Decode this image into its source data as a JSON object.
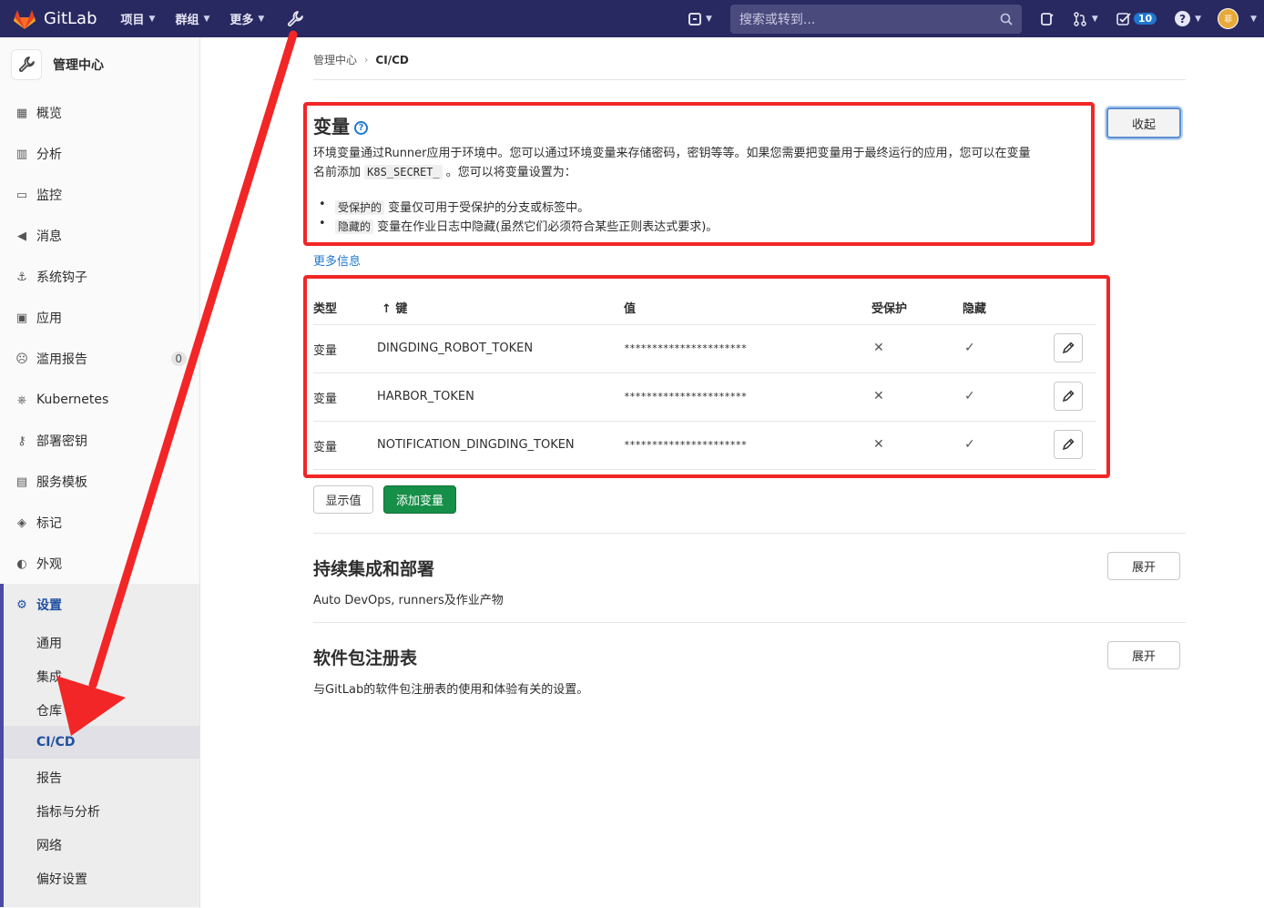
{
  "navbar": {
    "brand": "GitLab",
    "menu": [
      {
        "label": "项目"
      },
      {
        "label": "群组"
      },
      {
        "label": "更多"
      }
    ],
    "search_placeholder": "搜索或转到...",
    "todo_count": "10",
    "avatar_text": "菲"
  },
  "sidebar": {
    "title": "管理中心",
    "items": [
      {
        "label": "概览",
        "icon": "overview-icon"
      },
      {
        "label": "分析",
        "icon": "analytics-icon"
      },
      {
        "label": "监控",
        "icon": "monitor-icon"
      },
      {
        "label": "消息",
        "icon": "messages-icon"
      },
      {
        "label": "系统钩子",
        "icon": "hook-icon"
      },
      {
        "label": "应用",
        "icon": "applications-icon"
      },
      {
        "label": "滥用报告",
        "icon": "abuse-icon",
        "count": "0"
      },
      {
        "label": "Kubernetes",
        "icon": "kubernetes-icon"
      },
      {
        "label": "部署密钥",
        "icon": "key-icon"
      },
      {
        "label": "服务模板",
        "icon": "template-icon"
      },
      {
        "label": "标记",
        "icon": "label-icon"
      },
      {
        "label": "外观",
        "icon": "appearance-icon"
      }
    ],
    "settings": {
      "label": "设置",
      "sub": [
        "通用",
        "集成",
        "仓库",
        "CI/CD",
        "报告",
        "指标与分析",
        "网络",
        "偏好设置"
      ]
    }
  },
  "breadcrumb": {
    "parent": "管理中心",
    "current": "CI/CD"
  },
  "variables": {
    "title": "变量",
    "description_1": "环境变量通过Runner应用于环境中。您可以通过环境变量来存储密码，密钥等等。如果您需要把变量用于最终运行的应用，您可以在变量",
    "description_2_pre": "名前添加",
    "description_2_code": "K8S_SECRET_",
    "description_2_post": "。您可以将变量设置为：",
    "bullet_1_code": "受保护的",
    "bullet_1_text": "变量仅可用于受保护的分支或标签中。",
    "bullet_2_code": "隐藏的",
    "bullet_2_text": "变量在作业日志中隐藏(虽然它们必须符合某些正则表达式要求)。",
    "more_info": "更多信息",
    "collapse_label": "收起",
    "columns": {
      "type": "类型",
      "key": "↑ 键",
      "value": "值",
      "protected": "受保护",
      "masked": "隐藏"
    },
    "rows": [
      {
        "type": "变量",
        "key": "DINGDING_ROBOT_TOKEN",
        "value": "**********************",
        "protected": "✕",
        "masked": "✓"
      },
      {
        "type": "变量",
        "key": "HARBOR_TOKEN",
        "value": "**********************",
        "protected": "✕",
        "masked": "✓"
      },
      {
        "type": "变量",
        "key": "NOTIFICATION_DINGDING_TOKEN",
        "value": "**********************",
        "protected": "✕",
        "masked": "✓"
      }
    ],
    "reveal_label": "显示值",
    "add_label": "添加变量"
  },
  "ci_section": {
    "title": "持续集成和部署",
    "description": "Auto DevOps, runners及作业产物",
    "expand_label": "展开"
  },
  "registry_section": {
    "title": "软件包注册表",
    "description": "与GitLab的软件包注册表的使用和体验有关的设置。",
    "expand_label": "展开"
  },
  "colors": {
    "navbar": "#292961",
    "highlight": "#f22626",
    "link": "#1f78d1",
    "success": "#168f48"
  }
}
